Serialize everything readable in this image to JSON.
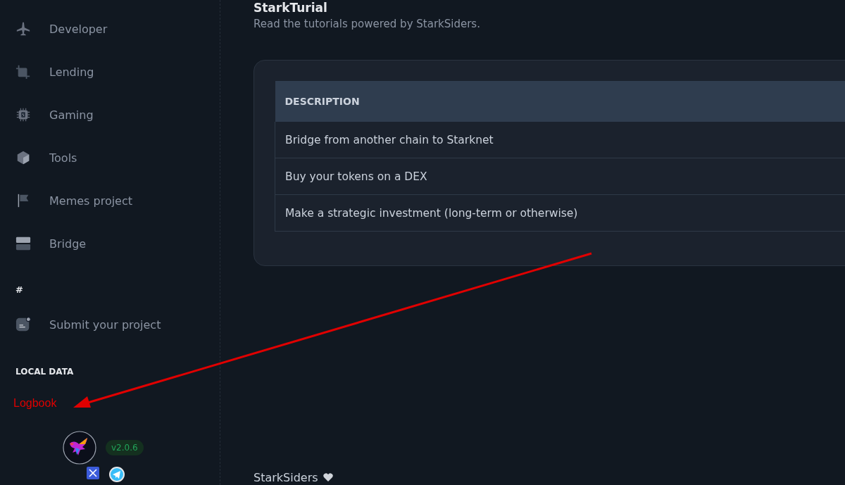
{
  "sidebar": {
    "items": [
      {
        "label": "Developer"
      },
      {
        "label": "Lending"
      },
      {
        "label": "Gaming"
      },
      {
        "label": "Tools"
      },
      {
        "label": "Memes project"
      },
      {
        "label": "Bridge"
      }
    ],
    "section_mark": "#",
    "submit_item": {
      "label": "Submit your project"
    },
    "local_data": {
      "heading": "LOCAL DATA",
      "items": [
        {
          "label": "Logbook"
        }
      ]
    },
    "version_badge": "v2.0.6"
  },
  "main": {
    "title": "StarkTurial",
    "subtitle": "Read the tutorials powered by StarkSiders.",
    "table": {
      "columns": [
        "DESCRIPTION"
      ],
      "rows": [
        [
          "Bridge from another chain to Starknet"
        ],
        [
          "Buy your tokens on a DEX"
        ],
        [
          "Make a strategic investment (long-term or otherwise)"
        ]
      ]
    },
    "footer": {
      "text": "StarkSiders"
    }
  }
}
